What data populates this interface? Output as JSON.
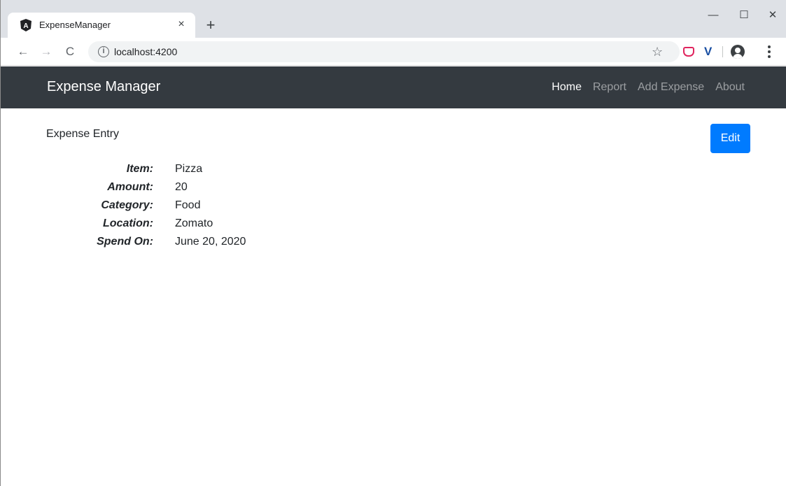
{
  "browser": {
    "tab": {
      "title": "ExpenseManager",
      "close_glyph": "×",
      "favicon_letter": "A",
      "favicon_icon": "angular-icon"
    },
    "new_tab_glyph": "+",
    "window_controls": {
      "minimize": "—",
      "maximize": "☐",
      "close": "✕"
    },
    "nav": {
      "back": "←",
      "forward": "→",
      "reload": "C"
    },
    "address": {
      "url": "localhost:4200",
      "info_glyph": "i"
    },
    "star_glyph": "☆",
    "extensions": [
      "pocket-icon",
      "v-extension-icon"
    ],
    "ext_v_letter": "V"
  },
  "app": {
    "brand": "Expense Manager",
    "nav": [
      {
        "label": "Home",
        "active": true
      },
      {
        "label": "Report",
        "active": false
      },
      {
        "label": "Add Expense",
        "active": false
      },
      {
        "label": "About",
        "active": false
      }
    ],
    "section_title": "Expense Entry",
    "edit_label": "Edit",
    "details": [
      {
        "label": "Item:",
        "value": "Pizza"
      },
      {
        "label": "Amount:",
        "value": "20"
      },
      {
        "label": "Category:",
        "value": "Food"
      },
      {
        "label": "Location:",
        "value": "Zomato"
      },
      {
        "label": "Spend On:",
        "value": "June 20, 2020"
      }
    ]
  },
  "colors": {
    "navbar_bg": "#343a40",
    "primary": "#007bff",
    "tabstrip_bg": "#dee1e6"
  }
}
